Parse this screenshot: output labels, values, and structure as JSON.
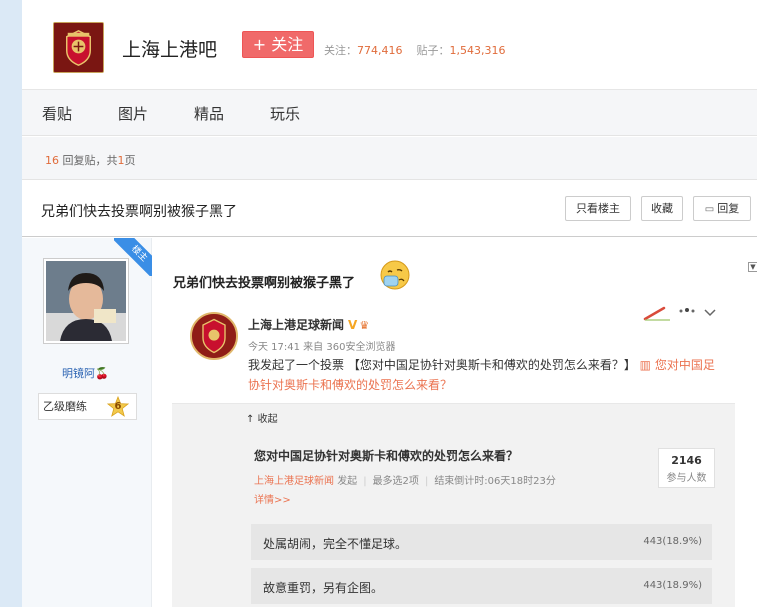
{
  "header": {
    "bar_title": "上海上港吧",
    "follow_label": "+ 关注",
    "followers_label": "关注：",
    "followers_count": "774,416",
    "posts_label": "贴子：",
    "posts_count": "1,543,316",
    "logo_icon": "shanghai-sipg-crest-icon"
  },
  "nav": {
    "items": [
      {
        "label": "看贴"
      },
      {
        "label": "图片"
      },
      {
        "label": "精品"
      },
      {
        "label": "玩乐"
      }
    ]
  },
  "replies": {
    "count": "16",
    "text": "回复贴，共",
    "pages": "1",
    "pages_suffix": "页"
  },
  "thread": {
    "title": "兄弟们快去投票啊别被猴子黑了",
    "btn_only_op": "只看楼主",
    "btn_collect": "收藏",
    "btn_reply": "回复"
  },
  "user": {
    "corner_label": "楼主",
    "name": "明镜阿",
    "level_title": "乙级磨练",
    "level": "6"
  },
  "post": {
    "title": "兄弟们快去投票啊别被猴子黑了",
    "emoji_icon": "sneeze-emoji-icon"
  },
  "weibo": {
    "account": "上海上港足球新闻",
    "time": "今天 17:41 来自 360安全浏览器",
    "text_prefix": "我发起了一个投票 【您对中国足协针对奥斯卡和傅欢的处罚怎么来看？】",
    "text_link": "您对中国足协针对奥斯卡和傅欢的处罚怎么来看？",
    "collapse": "收起",
    "vote": {
      "question": "您对中国足协针对奥斯卡和傅欢的处罚怎么来看？",
      "source": "上海上港足球新闻",
      "source_suffix": "发起",
      "max_select": "最多选2项",
      "countdown": "结束倒计时:06天18时23分",
      "detail": "详情>>",
      "participants": "2146",
      "participants_label": "参与人数",
      "options": [
        {
          "text": "处属胡闹，完全不懂足球。",
          "result": "443(18.9%)"
        },
        {
          "text": "故意重罚，另有企图。",
          "result": "443(18.9%)"
        }
      ]
    }
  },
  "colors": {
    "accent_orange": "#e06b3a",
    "follow_red": "#f06a6a",
    "link_blue": "#2d64b3",
    "ribbon_blue": "#3a8ee6",
    "weibo_orange": "#eb7350"
  }
}
